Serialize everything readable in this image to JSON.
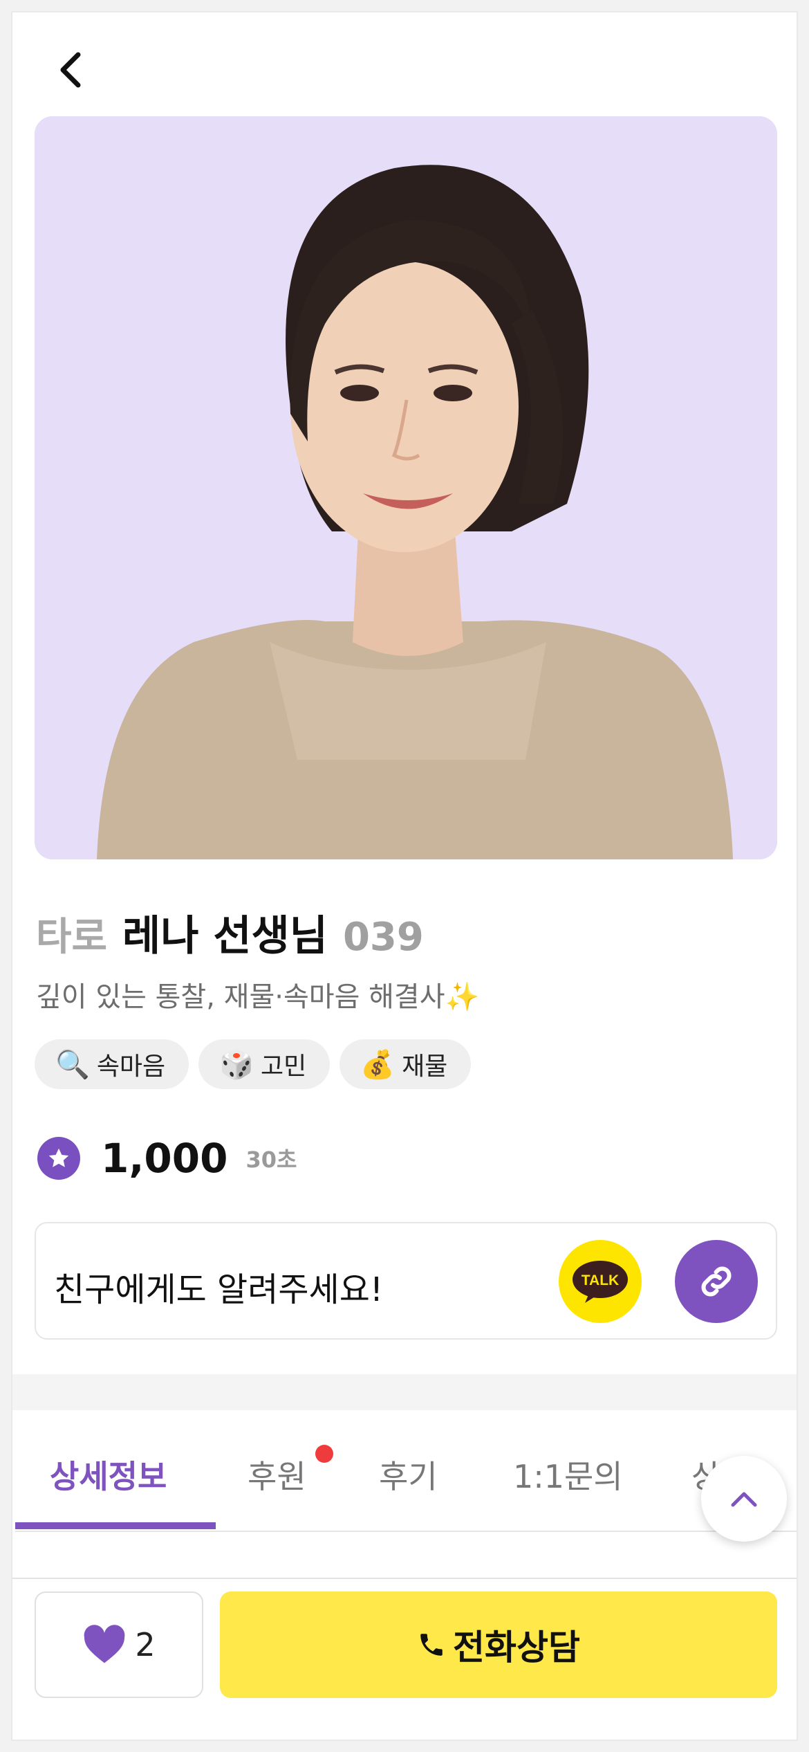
{
  "header": {
    "back_icon": "chevron-left-icon"
  },
  "profile": {
    "category": "타로",
    "name": "레나 선생님",
    "code": "039",
    "subtitle": "깊이 있는 통찰, 재물·속마음 해결사✨",
    "tags": [
      {
        "emoji": "🔍",
        "label": "속마음"
      },
      {
        "emoji": "🎲",
        "label": "고민"
      },
      {
        "emoji": "💰",
        "label": "재물"
      }
    ]
  },
  "price": {
    "amount": "1,000",
    "unit": "30초"
  },
  "share": {
    "text": "친구에게도 알려주세요!",
    "kakao_label": "TALK"
  },
  "tabs": [
    {
      "label": "상세정보"
    },
    {
      "label": "후원"
    },
    {
      "label": "후기"
    },
    {
      "label": "1:1문의"
    },
    {
      "label": "상품"
    }
  ],
  "footer": {
    "like_count": "2",
    "call_label": "전화상담"
  },
  "colors": {
    "accent": "#7e52bf",
    "call": "#ffe84a",
    "kakao": "#fee500",
    "notify": "#ef3b3b"
  }
}
